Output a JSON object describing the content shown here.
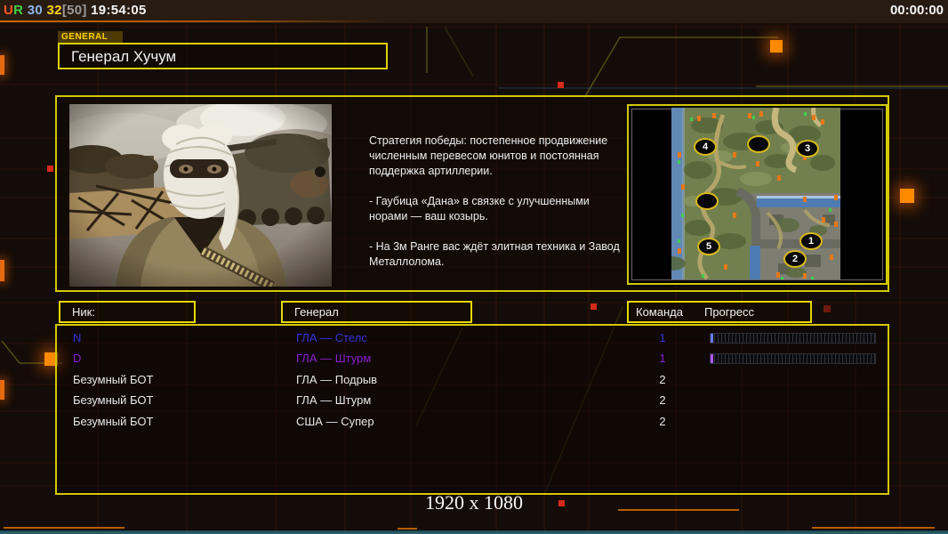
{
  "topbar": {
    "stats": [
      {
        "text": "U",
        "color": "#ff5a1e"
      },
      {
        "text": "R",
        "color": "#44d044"
      },
      {
        "text": " 30",
        "color": "#8db6ee"
      },
      {
        "text": " 32",
        "color": "#ffd21e"
      },
      {
        "text": "[50]",
        "color": "#9a9a9a"
      },
      {
        "text": " 19:54:05",
        "color": "#f5f5f5"
      }
    ],
    "match_time": "00:00:00"
  },
  "header": {
    "tab_label": "GENERAL",
    "title": "Генерал Хучум"
  },
  "briefing": {
    "paragraphs": [
      "Стратегия победы: постепенное продвижение численным перевесом юнитов и постоянная поддержка артиллерии.",
      "- Гаубица «Дана» в связке с улучшенными норами — ваш козырь.",
      "- На 3м Ранге вас ждёт элитная техника и Завод Металлолома."
    ]
  },
  "minimap": {
    "markers": [
      {
        "label": "4"
      },
      {
        "label": ""
      },
      {
        "label": "3"
      },
      {
        "label": ""
      },
      {
        "label": "5"
      },
      {
        "label": "1"
      },
      {
        "label": "2"
      }
    ]
  },
  "table": {
    "headers": {
      "nick": "Ник:",
      "general": "Генерал",
      "team": "Команда",
      "progress": "Прогресс"
    },
    "rows": [
      {
        "nick": "N",
        "general": "ГЛА — Стелс",
        "team": "1",
        "color": "#3434d6",
        "progress_color": "#6a78ff"
      },
      {
        "nick": "D",
        "general": "ГЛА — Штурм",
        "team": "1",
        "color": "#8a1ed2",
        "progress_color": "#b05aff"
      },
      {
        "nick": "Безумный БОТ",
        "general": "ГЛА — Подрыв",
        "team": "2",
        "color": "#e8e8e8",
        "progress_color": null
      },
      {
        "nick": "Безумный БОТ",
        "general": "ГЛА — Штурм",
        "team": "2",
        "color": "#e8e8e8",
        "progress_color": null
      },
      {
        "nick": "Безумный БОТ",
        "general": "США — Супер",
        "team": "2",
        "color": "#e8e8e8",
        "progress_color": null
      }
    ]
  },
  "footer": {
    "resolution": "1920 x 1080"
  },
  "colors": {
    "panel_border": "#d4c802",
    "accent_orange": "#ff8a00",
    "bottom_strip": "#2f6674"
  }
}
